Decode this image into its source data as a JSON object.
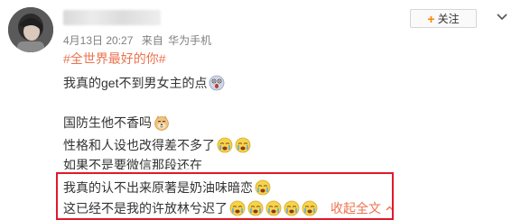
{
  "post": {
    "meta": {
      "date": "4月13日 20:27",
      "source_prefix": "来自",
      "source_device": "华为手机"
    },
    "follow_button": {
      "plus": "+",
      "label": "关注"
    },
    "lines": {
      "topic": "#全世界最好的你#",
      "line2": "我真的get不到男女主的点",
      "line3": "国防生他不香吗",
      "line4": "性格和人设也改得差不多了",
      "line5": "如果不是要微信那段还在",
      "line6": "我真的认不出来原著是奶油味暗恋",
      "line7": "这已经不是我的许放林兮迟了"
    },
    "collapse_link": {
      "label": "收起全文"
    },
    "icons": {
      "avatar": "avatar",
      "emoji_shocked": "shocked-face-icon",
      "emoji_doge": "doge-face-icon",
      "emoji_crying": "crying-face-icon",
      "more": "chevron-down-icon",
      "collapse": "chevron-up-icon"
    },
    "colors": {
      "topic": "#eb7350",
      "follow_plus": "#ff8200",
      "meta": "#808080",
      "highlight": "#e0192b"
    }
  }
}
